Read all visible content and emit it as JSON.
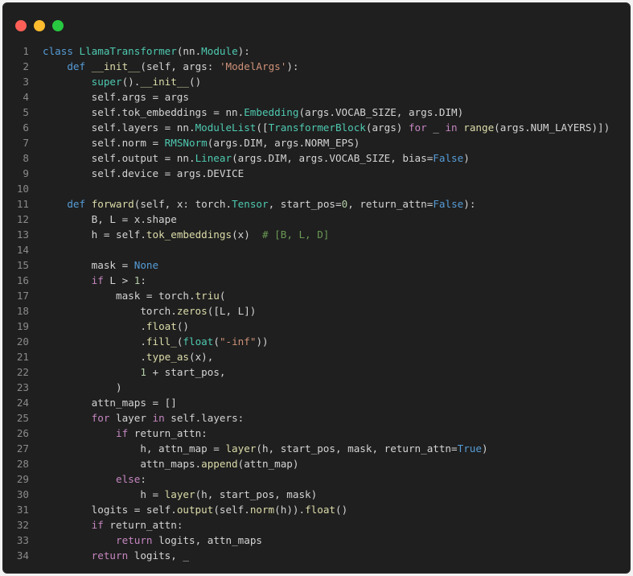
{
  "window": {
    "controls": [
      {
        "name": "close",
        "color": "#ff5f57"
      },
      {
        "name": "minimize",
        "color": "#febc2e"
      },
      {
        "name": "maximize",
        "color": "#28c840"
      }
    ]
  },
  "code": {
    "language": "python",
    "lines": [
      {
        "n": "1",
        "tokens": [
          [
            "class ",
            "kw"
          ],
          [
            "LlamaTransformer",
            "cls"
          ],
          [
            "(nn.",
            "p"
          ],
          [
            "Module",
            "cls"
          ],
          [
            "):",
            "p"
          ]
        ]
      },
      {
        "n": "2",
        "tokens": [
          [
            "    ",
            "p"
          ],
          [
            "def ",
            "kw"
          ],
          [
            "__init__",
            "fn"
          ],
          [
            "(self, args: ",
            "p"
          ],
          [
            "'ModelArgs'",
            "str"
          ],
          [
            "):",
            "p"
          ]
        ]
      },
      {
        "n": "3",
        "tokens": [
          [
            "        ",
            "p"
          ],
          [
            "super",
            "cls"
          ],
          [
            "().",
            "p"
          ],
          [
            "__init__",
            "fn"
          ],
          [
            "()",
            "p"
          ]
        ]
      },
      {
        "n": "4",
        "tokens": [
          [
            "        self.args = args",
            "p"
          ]
        ]
      },
      {
        "n": "5",
        "tokens": [
          [
            "        self.tok_embeddings = nn.",
            "p"
          ],
          [
            "Embedding",
            "cls"
          ],
          [
            "(args.VOCAB_SIZE, args.DIM)",
            "p"
          ]
        ]
      },
      {
        "n": "6",
        "tokens": [
          [
            "        self.layers = nn.",
            "p"
          ],
          [
            "ModuleList",
            "cls"
          ],
          [
            "([",
            "p"
          ],
          [
            "TransformerBlock",
            "cls"
          ],
          [
            "(args) ",
            "p"
          ],
          [
            "for",
            "ctl"
          ],
          [
            " _ ",
            "p"
          ],
          [
            "in",
            "ctl"
          ],
          [
            " ",
            "p"
          ],
          [
            "range",
            "fn"
          ],
          [
            "(args.NUM_LAYERS)])",
            "p"
          ]
        ]
      },
      {
        "n": "7",
        "tokens": [
          [
            "        self.norm = ",
            "p"
          ],
          [
            "RMSNorm",
            "cls"
          ],
          [
            "(args.DIM, args.NORM_EPS)",
            "p"
          ]
        ]
      },
      {
        "n": "8",
        "tokens": [
          [
            "        self.output = nn.",
            "p"
          ],
          [
            "Linear",
            "cls"
          ],
          [
            "(args.DIM, args.VOCAB_SIZE, bias=",
            "p"
          ],
          [
            "False",
            "const"
          ],
          [
            ")",
            "p"
          ]
        ]
      },
      {
        "n": "9",
        "tokens": [
          [
            "        self.device = args.DEVICE",
            "p"
          ]
        ]
      },
      {
        "n": "10",
        "tokens": []
      },
      {
        "n": "11",
        "tokens": [
          [
            "    ",
            "p"
          ],
          [
            "def ",
            "kw"
          ],
          [
            "forward",
            "fn"
          ],
          [
            "(self, x: torch.",
            "p"
          ],
          [
            "Tensor",
            "cls"
          ],
          [
            ", start_pos=",
            "p"
          ],
          [
            "0",
            "num"
          ],
          [
            ", return_attn=",
            "p"
          ],
          [
            "False",
            "const"
          ],
          [
            "):",
            "p"
          ]
        ]
      },
      {
        "n": "12",
        "tokens": [
          [
            "        B, L = x.shape",
            "p"
          ]
        ]
      },
      {
        "n": "13",
        "tokens": [
          [
            "        h = self.",
            "p"
          ],
          [
            "tok_embeddings",
            "fn"
          ],
          [
            "(x)  ",
            "p"
          ],
          [
            "# [B, L, D]",
            "com"
          ]
        ]
      },
      {
        "n": "14",
        "tokens": []
      },
      {
        "n": "15",
        "tokens": [
          [
            "        mask = ",
            "p"
          ],
          [
            "None",
            "const"
          ]
        ]
      },
      {
        "n": "16",
        "tokens": [
          [
            "        ",
            "p"
          ],
          [
            "if",
            "ctl"
          ],
          [
            " L > ",
            "p"
          ],
          [
            "1",
            "num"
          ],
          [
            ":",
            "p"
          ]
        ]
      },
      {
        "n": "17",
        "tokens": [
          [
            "            mask = torch.",
            "p"
          ],
          [
            "triu",
            "fn"
          ],
          [
            "(",
            "p"
          ]
        ]
      },
      {
        "n": "18",
        "tokens": [
          [
            "                torch.",
            "p"
          ],
          [
            "zeros",
            "fn"
          ],
          [
            "([L, L])",
            "p"
          ]
        ]
      },
      {
        "n": "19",
        "tokens": [
          [
            "                .",
            "p"
          ],
          [
            "float",
            "fn"
          ],
          [
            "()",
            "p"
          ]
        ]
      },
      {
        "n": "20",
        "tokens": [
          [
            "                .",
            "p"
          ],
          [
            "fill_",
            "fn"
          ],
          [
            "(",
            "p"
          ],
          [
            "float",
            "cls"
          ],
          [
            "(",
            "p"
          ],
          [
            "\"-inf\"",
            "str"
          ],
          [
            "))",
            "p"
          ]
        ]
      },
      {
        "n": "21",
        "tokens": [
          [
            "                .",
            "p"
          ],
          [
            "type_as",
            "fn"
          ],
          [
            "(x),",
            "p"
          ]
        ]
      },
      {
        "n": "22",
        "tokens": [
          [
            "                ",
            "p"
          ],
          [
            "1",
            "num"
          ],
          [
            " + start_pos,",
            "p"
          ]
        ]
      },
      {
        "n": "23",
        "tokens": [
          [
            "            )",
            "p"
          ]
        ]
      },
      {
        "n": "24",
        "tokens": [
          [
            "        attn_maps = []",
            "p"
          ]
        ]
      },
      {
        "n": "25",
        "tokens": [
          [
            "        ",
            "p"
          ],
          [
            "for",
            "ctl"
          ],
          [
            " layer ",
            "p"
          ],
          [
            "in",
            "ctl"
          ],
          [
            " self.layers:",
            "p"
          ]
        ]
      },
      {
        "n": "26",
        "tokens": [
          [
            "            ",
            "p"
          ],
          [
            "if",
            "ctl"
          ],
          [
            " return_attn:",
            "p"
          ]
        ]
      },
      {
        "n": "27",
        "tokens": [
          [
            "                h, attn_map = ",
            "p"
          ],
          [
            "layer",
            "fn"
          ],
          [
            "(h, start_pos, mask, return_attn=",
            "p"
          ],
          [
            "True",
            "const"
          ],
          [
            ")",
            "p"
          ]
        ]
      },
      {
        "n": "28",
        "tokens": [
          [
            "                attn_maps.",
            "p"
          ],
          [
            "append",
            "fn"
          ],
          [
            "(attn_map)",
            "p"
          ]
        ]
      },
      {
        "n": "29",
        "tokens": [
          [
            "            ",
            "p"
          ],
          [
            "else",
            "ctl"
          ],
          [
            ":",
            "p"
          ]
        ]
      },
      {
        "n": "30",
        "tokens": [
          [
            "                h = ",
            "p"
          ],
          [
            "layer",
            "fn"
          ],
          [
            "(h, start_pos, mask)",
            "p"
          ]
        ]
      },
      {
        "n": "31",
        "tokens": [
          [
            "        logits = self.",
            "p"
          ],
          [
            "output",
            "fn"
          ],
          [
            "(self.",
            "p"
          ],
          [
            "norm",
            "fn"
          ],
          [
            "(h)).",
            "p"
          ],
          [
            "float",
            "fn"
          ],
          [
            "()",
            "p"
          ]
        ]
      },
      {
        "n": "32",
        "tokens": [
          [
            "        ",
            "p"
          ],
          [
            "if",
            "ctl"
          ],
          [
            " return_attn:",
            "p"
          ]
        ]
      },
      {
        "n": "33",
        "tokens": [
          [
            "            ",
            "p"
          ],
          [
            "return",
            "ctl"
          ],
          [
            " logits, attn_maps",
            "p"
          ]
        ]
      },
      {
        "n": "34",
        "tokens": [
          [
            "        ",
            "p"
          ],
          [
            "return",
            "ctl"
          ],
          [
            " logits, _",
            "p"
          ]
        ]
      }
    ]
  }
}
